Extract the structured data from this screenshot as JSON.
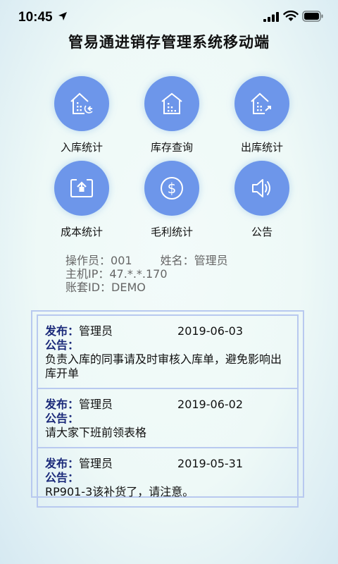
{
  "status_bar": {
    "time": "10:45",
    "icons": [
      "location-arrow-icon",
      "signal-icon",
      "wifi-icon",
      "battery-icon"
    ]
  },
  "app": {
    "title": "管易通进销存管理系统移动端"
  },
  "features": [
    {
      "label": "入库统计",
      "icon": "warehouse-in-icon"
    },
    {
      "label": "库存查询",
      "icon": "warehouse-stock-icon"
    },
    {
      "label": "出库统计",
      "icon": "warehouse-out-icon"
    },
    {
      "label": "成本统计",
      "icon": "upload-box-icon"
    },
    {
      "label": "毛利统计",
      "icon": "dollar-icon"
    },
    {
      "label": "公告",
      "icon": "speaker-icon"
    }
  ],
  "info": {
    "operator_label": "操作员：",
    "operator_value": "001",
    "name_label": "姓名：",
    "name_value": "管理员",
    "host_label": "主机IP：",
    "host_value": "47.*.*.170",
    "account_label": "账套ID：",
    "account_value": "DEMO"
  },
  "notices": [
    {
      "publisher_label": "发布：",
      "publisher": "管理员",
      "date": "2019-06-03",
      "notice_label": "公告：",
      "content": "负责入库的同事请及时审核入库单，避免影响出库开单"
    },
    {
      "publisher_label": "发布：",
      "publisher": "管理员",
      "date": "2019-06-02",
      "notice_label": "公告：",
      "content": "请大家下班前领表格"
    },
    {
      "publisher_label": "发布：",
      "publisher": "管理员",
      "date": "2019-05-31",
      "notice_label": "公告：",
      "content": "RP901-3该补货了，请注意。"
    }
  ],
  "colors": {
    "accent": "#6d96ea",
    "notice_label": "#1b2a7a",
    "panel_border": "#b8c9ef",
    "info_text": "#666666"
  }
}
